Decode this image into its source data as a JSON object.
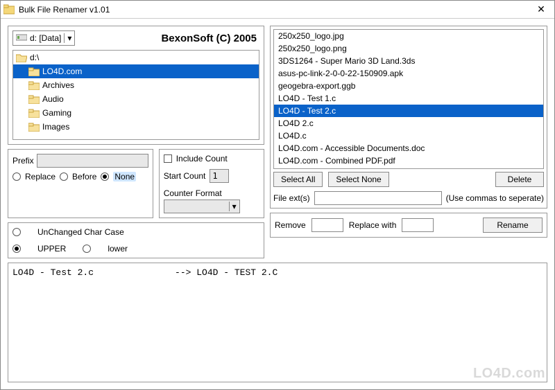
{
  "window": {
    "title": "Bulk File Renamer v1.01"
  },
  "drive": {
    "label": "d: [Data]"
  },
  "brand": "BexonSoft (C) 2005",
  "tree": {
    "root": "d:\\",
    "items": [
      "LO4D.com",
      "Archives",
      "Audio",
      "Gaming",
      "Images"
    ],
    "selected": "LO4D.com"
  },
  "prefix": {
    "label": "Prefix",
    "value": "",
    "replace": "Replace",
    "before": "Before",
    "none": "None",
    "selected": "None"
  },
  "charcase": {
    "unchanged": "UnChanged Char Case",
    "upper": "UPPER",
    "lower": "lower",
    "selected": "UPPER"
  },
  "count": {
    "include": "Include Count",
    "start_label": "Start Count",
    "start_value": "1",
    "format_label": "Counter Format",
    "format_value": ""
  },
  "files": {
    "items": [
      "250x250_logo.jpg",
      "250x250_logo.png",
      "3DS1264 - Super Mario 3D Land.3ds",
      "asus-pc-link-2-0-0-22-150909.apk",
      "geogebra-export.ggb",
      "LO4D - Test 1.c",
      "LO4D - Test 2.c",
      "LO4D 2.c",
      "LO4D.c",
      "LO4D.com - Accessible Documents.doc",
      "LO4D.com - Combined PDF.pdf"
    ],
    "selected": "LO4D - Test 2.c"
  },
  "buttons": {
    "select_all": "Select All",
    "select_none": "Select None",
    "delete": "Delete",
    "rename": "Rename"
  },
  "ext": {
    "label": "File ext(s)",
    "value": "",
    "hint": "(Use commas to seperate)"
  },
  "remove": {
    "label": "Remove",
    "value": "",
    "replace_label": "Replace with",
    "replace_value": ""
  },
  "output": "LO4D - Test 2.c               --> LO4D - TEST 2.C",
  "watermark": "LO4D.com"
}
